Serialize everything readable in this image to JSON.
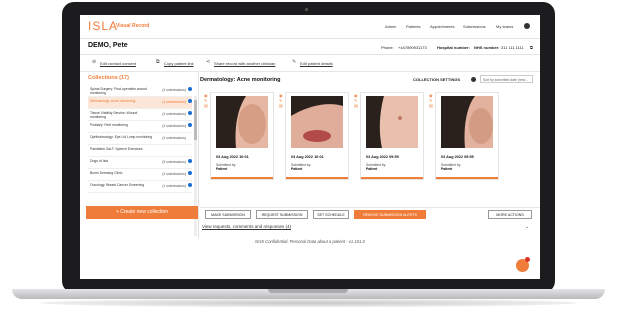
{
  "app": {
    "logo": "ISLA",
    "subtitle": "Visual Record"
  },
  "nav": [
    "Admin",
    "Patients",
    "Appointments",
    "Submissions",
    "My teams"
  ],
  "patient": {
    "name": "DEMO, Pete",
    "phone_label": "Phone:",
    "phone": "+447890931173",
    "hospital_label": "Hospital number:",
    "nhs_label": "NHS number:",
    "nhs": "311 111 1111"
  },
  "actions": [
    "Edit contact consent",
    "Copy patient link",
    "Share record with another clinician",
    "Edit patient details"
  ],
  "collections": {
    "title": "Collections (17)",
    "items": [
      {
        "name": "Spinal Surgery: Post-operative wound monitoring",
        "count": "(4 submissions)"
      },
      {
        "name": "Dermatology: Acne monitoring",
        "count": "(4 submissions)"
      },
      {
        "name": "Tissue Viability Service: Wound monitoring",
        "count": "(4 submissions)"
      },
      {
        "name": "Podiatry: Feet monitoring",
        "count": "(4 submissions)"
      },
      {
        "name": "Ophthalmology: Eye Lid Lump monitoring",
        "count": "(4 submissions)"
      },
      {
        "name": "Paediatric SaLT: Speech Exercises",
        "count": ""
      },
      {
        "name": "Dogs of Isla",
        "count": "(5 submissions)"
      },
      {
        "name": "Burns Dressing Clinic",
        "count": "(4 submissions)"
      },
      {
        "name": "Oncology: Breast Cancer Screening",
        "count": "(1 submissions)"
      }
    ],
    "create_label": "+ Create new collection"
  },
  "main": {
    "title": "Dermatology: Acne monitoring",
    "settings_label": "COLLECTION SETTINGS",
    "sort_label": "Sort by submitted date (new..."
  },
  "cards": [
    {
      "date": "03 Aug 2022 10:01",
      "by_label": "Submitted by:",
      "by": "Patient"
    },
    {
      "date": "03 Aug 2022 10:01",
      "by_label": "Submitted by:",
      "by": "Patient"
    },
    {
      "date": "03 Aug 2022 09:55",
      "by_label": "Submitted by:",
      "by": "Patient"
    },
    {
      "date": "03 Aug 2022 09:55",
      "by_label": "Submitted by:",
      "by": "Patient"
    }
  ],
  "bottom": {
    "make": "MAKE SUBMISSION",
    "request": "REQUEST SUBMISSION",
    "schedule": "SET SCHEDULE",
    "remove": "REMOVE SUBMISSION ALERTS",
    "more": "MORE ACTIONS",
    "view_requests": "View requests, comments and responses (4)"
  },
  "footer": "NHS Confidential: Personal Data about a patient - v1.101.0"
}
